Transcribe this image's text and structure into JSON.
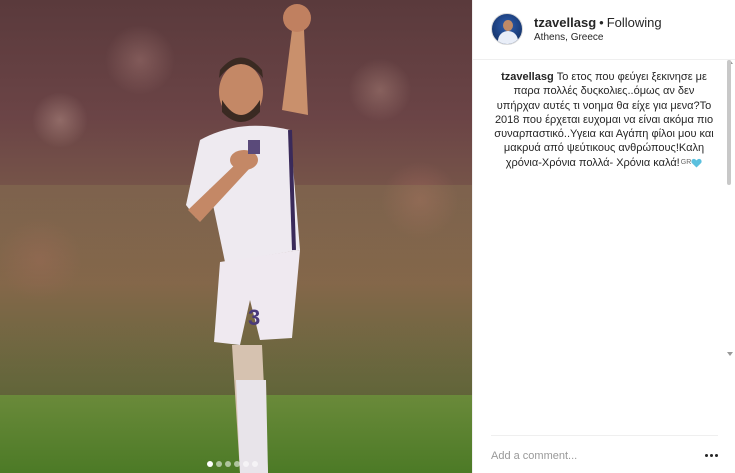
{
  "post": {
    "username": "tzavellasg",
    "separator": "•",
    "follow_status": "Following",
    "location": "Athens, Greece",
    "caption_user": "tzavellasg",
    "caption_text": "Το ετος που φεύγει ξεκινησε με παρα πολλές δυςκολιες..όμως αν δεν υπήρχαν αυτές τι νοημα θα είχε για μενα?Το 2018 που έρχεται ευχομαι να είναι ακόμα πιο συναρπαστικό..Υγεια και Αγάπη φίλοι μου και μακρυά από ψεύτικους ανθρώπους!Καλη χρόνια-Χρόνια πολλά- Χρόνια καλά!",
    "flag_text": "GR",
    "comment_placeholder": "Add a comment...",
    "carousel": {
      "count": 6,
      "active_index": 0
    }
  },
  "colors": {
    "heart": "#5bc0de",
    "text": "#262626",
    "muted": "#999999"
  },
  "icons": [
    "heart-icon",
    "more-options-icon",
    "avatar"
  ]
}
